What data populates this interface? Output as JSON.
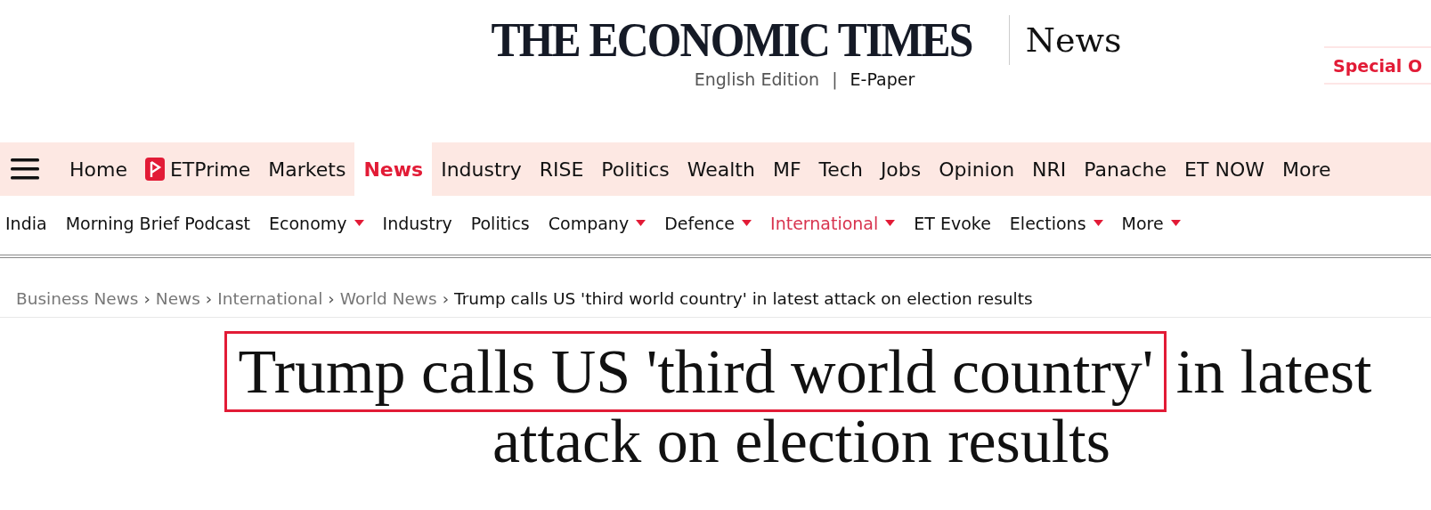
{
  "masthead": {
    "logo": "THE ECONOMIC TIMES",
    "section": "News",
    "edition": "English Edition",
    "separator": "|",
    "epaper": "E-Paper",
    "offer": "Special O"
  },
  "nav": [
    {
      "kind": "link",
      "label": "Home",
      "selected": false
    },
    {
      "kind": "prime",
      "label": "ETPrime",
      "selected": false
    },
    {
      "kind": "link",
      "label": "Markets",
      "selected": false
    },
    {
      "kind": "link",
      "label": "News",
      "selected": true
    },
    {
      "kind": "link",
      "label": "Industry",
      "selected": false
    },
    {
      "kind": "link",
      "label": "RISE",
      "selected": false
    },
    {
      "kind": "link",
      "label": "Politics",
      "selected": false
    },
    {
      "kind": "link",
      "label": "Wealth",
      "selected": false
    },
    {
      "kind": "link",
      "label": "MF",
      "selected": false
    },
    {
      "kind": "link",
      "label": "Tech",
      "selected": false
    },
    {
      "kind": "link",
      "label": "Jobs",
      "selected": false
    },
    {
      "kind": "link",
      "label": "Opinion",
      "selected": false
    },
    {
      "kind": "link",
      "label": "NRI",
      "selected": false
    },
    {
      "kind": "link",
      "label": "Panache",
      "selected": false
    },
    {
      "kind": "link",
      "label": "ET NOW",
      "selected": false
    },
    {
      "kind": "link",
      "label": "More",
      "selected": false
    }
  ],
  "subnav": [
    {
      "label": "India",
      "dropdown": false,
      "selected": false
    },
    {
      "label": "Morning Brief Podcast",
      "dropdown": false,
      "selected": false
    },
    {
      "label": "Economy",
      "dropdown": true,
      "selected": false
    },
    {
      "label": "Industry",
      "dropdown": false,
      "selected": false
    },
    {
      "label": "Politics",
      "dropdown": false,
      "selected": false
    },
    {
      "label": "Company",
      "dropdown": true,
      "selected": false
    },
    {
      "label": "Defence",
      "dropdown": true,
      "selected": false
    },
    {
      "label": "International",
      "dropdown": true,
      "selected": true
    },
    {
      "label": "ET Evoke",
      "dropdown": false,
      "selected": false
    },
    {
      "label": "Elections",
      "dropdown": true,
      "selected": false
    },
    {
      "label": "More",
      "dropdown": true,
      "selected": false
    }
  ],
  "breadcrumb": [
    {
      "label": "Business News",
      "current": false
    },
    {
      "label": "News",
      "current": false
    },
    {
      "label": "International",
      "current": false
    },
    {
      "label": "World News",
      "current": false
    },
    {
      "label": "Trump calls US 'third world country' in latest attack on election results",
      "current": true
    }
  ],
  "breadcrumb_separator": "›",
  "headline": {
    "highlighted": "Trump calls US 'third world country'",
    "rest": "in latest attack on election results"
  }
}
